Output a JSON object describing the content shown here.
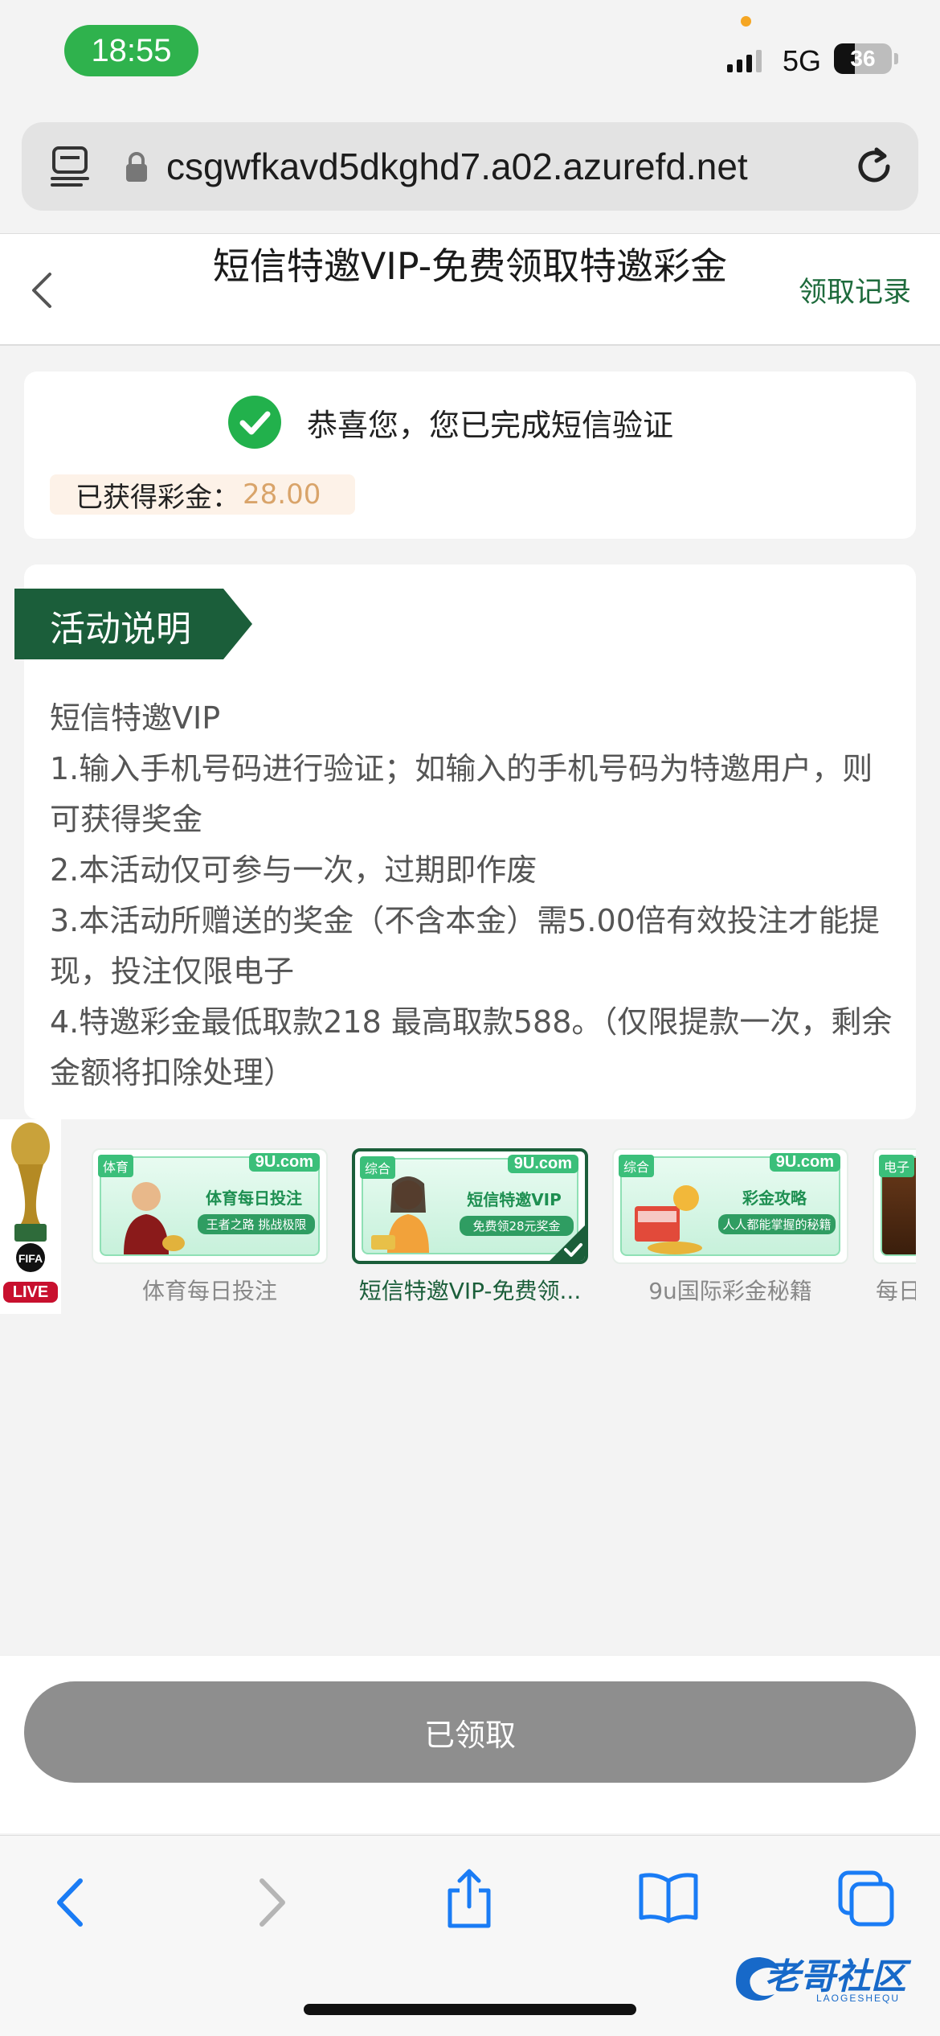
{
  "status_bar": {
    "time": "18:55",
    "network": "5G",
    "battery": "36"
  },
  "browser": {
    "url": "csgwfkavd5dkghd7.a02.azurefd.net"
  },
  "header": {
    "title": "短信特邀VIP-免费领取特邀彩金",
    "record_link": "领取记录"
  },
  "success": {
    "message": "恭喜您，您已完成短信验证",
    "reward_label": "已获得彩金：",
    "reward_amount": "28.00"
  },
  "activity": {
    "tag": "活动说明",
    "lines": [
      "短信特邀VIP",
      "1.输入手机号码进行验证；如输入的手机号码为特邀用户，则可获得奖金",
      "2.本活动仅可参与一次，过期即作废",
      "3.本活动所赠送的奖金（不含本金）需5.00倍有效投注才能提现，投注仅限电子",
      "4.特邀彩金最低取款218  最高取款588。（仅限提款一次，剩余金额将扣除处理）"
    ]
  },
  "live_badge": {
    "label": "LIVE",
    "fifa": "FIFA"
  },
  "promos": [
    {
      "caption": "体育每日投注",
      "brand": "9U.com",
      "corner": "体育",
      "headline": "体育每日投注",
      "sub": "王者之路 挑战极限",
      "selected": false
    },
    {
      "caption": "短信特邀VIP-免费领...",
      "brand": "9U.com",
      "corner": "综合",
      "headline": "短信特邀VIP",
      "sub": "免费领28元奖金",
      "selected": true
    },
    {
      "caption": "9u国际彩金秘籍",
      "brand": "9U.com",
      "corner": "综合",
      "headline": "彩金攻略",
      "sub": "人人都能掌握的秘籍",
      "selected": false
    },
    {
      "caption": "每日",
      "brand": "",
      "corner": "电子",
      "headline": "",
      "sub": "",
      "selected": false
    }
  ],
  "claim_button": {
    "label": "已领取"
  },
  "watermark": {
    "text": "老哥社区",
    "sub": "LAOGESHEQU"
  },
  "colors": {
    "brand_green": "#1b5e3a",
    "success_green": "#22b14c",
    "amount": "#d9a46a",
    "button_disabled": "#8e8e8e"
  }
}
